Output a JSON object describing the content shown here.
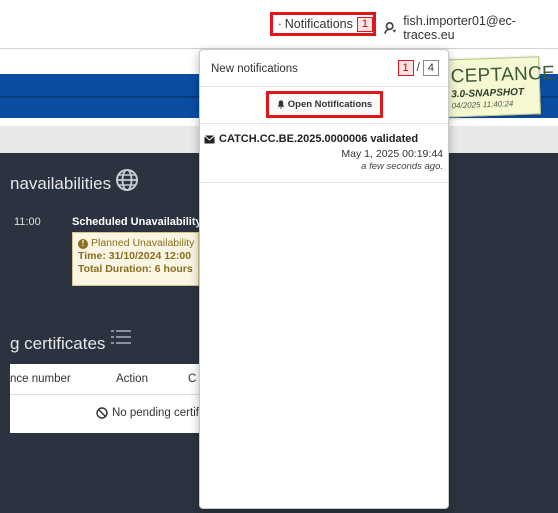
{
  "topbar": {
    "notifications_label": "Notifications",
    "notifications_count": "1",
    "user_email": "fish.importer01@ec-traces.eu"
  },
  "environment": {
    "label": "CEPTANCE",
    "version": "3.0-SNAPSHOT",
    "date": "04/2025 11:40:24"
  },
  "unavailabilities": {
    "title": "navailabilities",
    "time": "11:00",
    "scheduled_label": "Scheduled Unavailability",
    "planned_label": "Planned Unavailability",
    "time_line": "Time: 31/10/2024 12:00",
    "duration_line": "Total Duration: 6 hours"
  },
  "certificates": {
    "title": "g certificates",
    "columns": [
      "nce number",
      "Action",
      "C"
    ],
    "empty_text": "No pending certifi"
  },
  "dropdown": {
    "header": "New notifications",
    "new_count": "1",
    "separator": "/",
    "total_count": "4",
    "open_button": "Open Notifications",
    "items": [
      {
        "title": "CATCH.CC.BE.2025.0000006 validated",
        "date": "May 1, 2025 00:19:44",
        "ago": "a few seconds ago."
      }
    ]
  },
  "colors": {
    "accent_red": "#e0161b",
    "brand_blue": "#0b4da2",
    "dark_bg": "#2c3340"
  }
}
